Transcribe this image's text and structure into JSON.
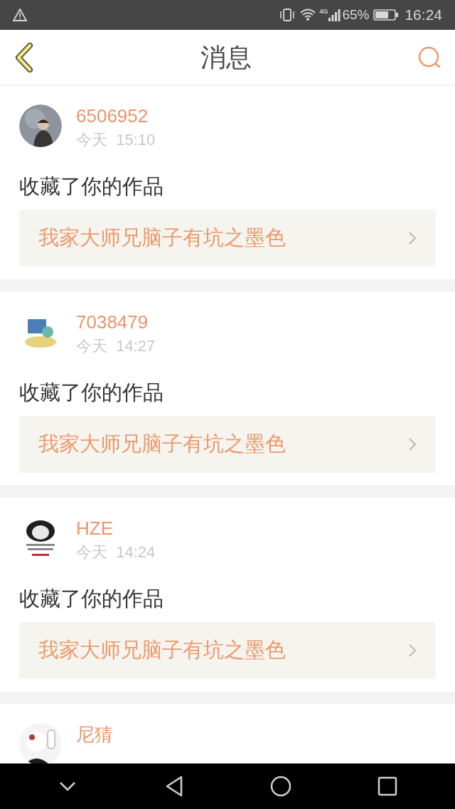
{
  "status_bar": {
    "network": "4G",
    "battery": "65%",
    "time": "16:24"
  },
  "header": {
    "title": "消息"
  },
  "messages": [
    {
      "name": "6506952",
      "time": "今天  15:10",
      "action": "收藏了你的作品",
      "work": "我家大师兄脑子有坑之墨色"
    },
    {
      "name": "7038479",
      "time": "今天  14:27",
      "action": "收藏了你的作品",
      "work": "我家大师兄脑子有坑之墨色"
    },
    {
      "name": "HZE",
      "time": "今天  14:24",
      "action": "收藏了你的作品",
      "work": "我家大师兄脑子有坑之墨色"
    },
    {
      "name": "尼猜"
    }
  ]
}
